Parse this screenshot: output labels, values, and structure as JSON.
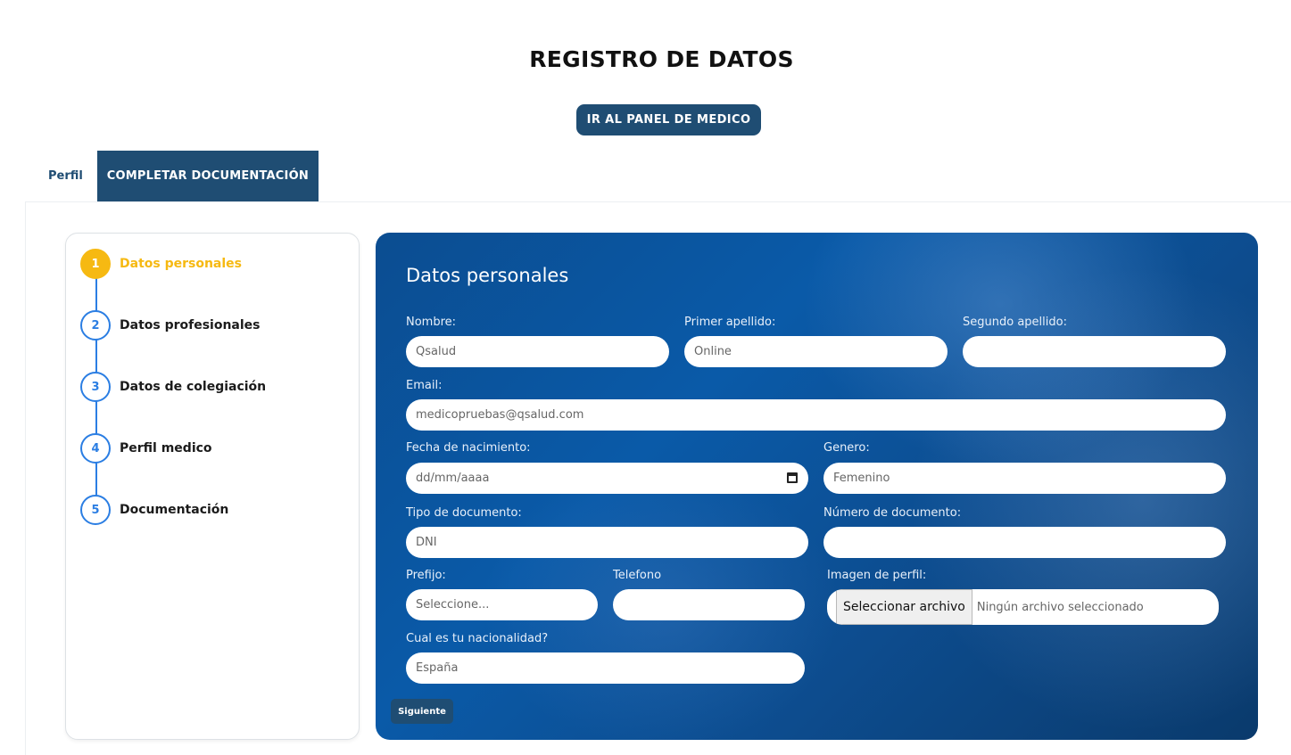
{
  "header": {
    "title": "REGISTRO DE DATOS",
    "panel_button": "IR AL PANEL DE MEDICO"
  },
  "tabs": [
    {
      "label": "Perfil"
    },
    {
      "label": "COMPLETAR DOCUMENTACIÓN",
      "active": true
    }
  ],
  "steps": [
    {
      "number": "1",
      "label": "Datos personales",
      "active": true
    },
    {
      "number": "2",
      "label": "Datos profesionales"
    },
    {
      "number": "3",
      "label": "Datos de colegiación"
    },
    {
      "number": "4",
      "label": "Perfil medico"
    },
    {
      "number": "5",
      "label": "Documentación"
    }
  ],
  "colors": {
    "primary": "#1f4d73",
    "step_blue": "#2b7ee3",
    "active_yellow": "#f6b912",
    "card_blue": "#0b4d91"
  },
  "form": {
    "title": "Datos personales",
    "fields": {
      "nombre": {
        "label": "Nombre:",
        "value": "Qsalud"
      },
      "primer_apellido": {
        "label": "Primer apellido:",
        "value": "Online"
      },
      "segundo_apellido": {
        "label": "Segundo apellido:",
        "value": ""
      },
      "email": {
        "label": "Email:",
        "value": "medicopruebas@qsalud.com"
      },
      "fecha_nacimiento": {
        "label": "Fecha de nacimiento:",
        "placeholder": "dd/mm/aaaa"
      },
      "genero": {
        "label": "Genero:",
        "value": "Femenino"
      },
      "tipo_documento": {
        "label": "Tipo de documento:",
        "value": "DNI"
      },
      "numero_documento": {
        "label": "Número de documento:",
        "value": ""
      },
      "prefijo": {
        "label": "Prefijo:",
        "value": "Seleccione..."
      },
      "telefono": {
        "label": "Telefono",
        "value": ""
      },
      "imagen_perfil": {
        "label": "Imagen de perfil:",
        "button": "Seleccionar archivo",
        "status": "Ningún archivo seleccionado"
      },
      "nacionalidad": {
        "label": "Cual es tu nacionalidad?",
        "value": "España"
      }
    },
    "next_button": "Siguiente"
  }
}
